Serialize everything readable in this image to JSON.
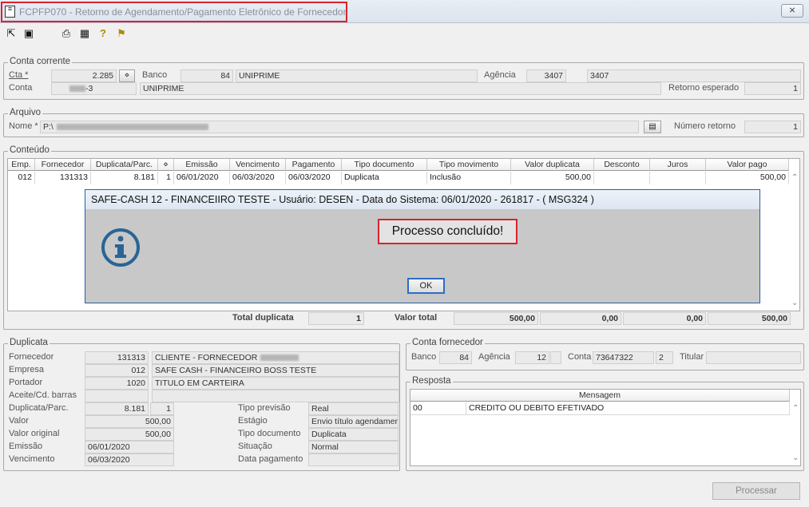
{
  "window": {
    "title": "FCPFP070 - Retorno de Agendamento/Pagamento Eletrônico de Fornecedor",
    "close_glyph": "⨯"
  },
  "toolbar": {
    "icons": [
      "exit-icon",
      "restore-icon",
      "print-icon",
      "calendar-icon",
      "help-icon",
      "bookmark-icon"
    ]
  },
  "conta": {
    "legend": "Conta corrente",
    "cta_label": "Cta *",
    "cta_value": "2.285",
    "banco_label": "Banco",
    "banco_code": "84",
    "banco_name": "UNIPRIME",
    "agencia_label": "Agência",
    "agencia_code": "3407",
    "agencia_name": "3407",
    "conta_label": "Conta",
    "conta_value": "-3",
    "conta_name": "UNIPRIME",
    "retorno_label": "Retorno esperado",
    "retorno_value": "1"
  },
  "arquivo": {
    "legend": "Arquivo",
    "nome_label": "Nome *",
    "nome_value": "P:\\",
    "numero_label": "Número retorno",
    "numero_value": "1"
  },
  "conteudo": {
    "legend": "Conteúdo",
    "headers": [
      "Emp.",
      "Fornecedor",
      "Duplicata/Parc.",
      "",
      "Emissão",
      "Vencimento",
      "Pagamento",
      "Tipo documento",
      "Tipo movimento",
      "Valor duplicata",
      "Desconto",
      "Juros",
      "Valor pago"
    ],
    "row": [
      "012",
      "131313",
      "8.181",
      "1",
      "06/01/2020",
      "06/03/2020",
      "06/03/2020",
      "Duplicata",
      "Inclusão",
      "500,00",
      "",
      "",
      "500,00"
    ],
    "total_dup_label": "Total duplicata",
    "total_dup_value": "1",
    "valor_total_label": "Valor total",
    "totals": [
      "500,00",
      "0,00",
      "0,00",
      "500,00"
    ]
  },
  "dialog": {
    "title": "SAFE-CASH 12 - FINANCEIIRO TESTE - Usuário: DESEN - Data do Sistema: 06/01/2020 - 261817 - ( MSG324 )",
    "message": "Processo concluído!",
    "ok_label": "OK",
    "icon": "info-icon",
    "accent": "#2a6496"
  },
  "duplicata": {
    "legend": "Duplicata",
    "fornecedor_label": "Fornecedor",
    "fornecedor_code": "131313",
    "fornecedor_name": "CLIENTE - FORNECEDOR",
    "empresa_label": "Empresa",
    "empresa_code": "012",
    "empresa_name": "SAFE CASH - FINANCEIRO BOSS TESTE",
    "portador_label": "Portador",
    "portador_code": "1020",
    "portador_name": "TITULO EM CARTEIRA",
    "aceite_label": "Aceite/Cd. barras",
    "dupparc_label": "Duplicata/Parc.",
    "dup_value": "8.181",
    "parc_value": "1",
    "valor_label": "Valor",
    "valor_value": "500,00",
    "valor_original_label": "Valor original",
    "valor_original_value": "500,00",
    "emissao_label": "Emissão",
    "emissao_value": "06/01/2020",
    "vencimento_label": "Vencimento",
    "vencimento_value": "06/03/2020",
    "tipo_previsao_label": "Tipo previsão",
    "tipo_previsao_value": "Real",
    "estagio_label": "Estágio",
    "estagio_value": "Envio título agendamen",
    "tipo_documento_label": "Tipo documento",
    "tipo_documento_value": "Duplicata",
    "situacao_label": "Situação",
    "situacao_value": "Normal",
    "data_pagamento_label": "Data pagamento",
    "data_pagamento_value": ""
  },
  "conta_fornecedor": {
    "legend": "Conta fornecedor",
    "banco_label": "Banco",
    "banco_value": "84",
    "agencia_label": "Agência",
    "agencia_value": "12",
    "conta_label": "Conta",
    "conta_value": "73647322",
    "conta_dv": "2",
    "titular_label": "Titular",
    "titular_value": ""
  },
  "resposta": {
    "legend": "Resposta",
    "header": "Mensagem",
    "code": "00",
    "message": "CREDITO OU DEBITO EFETIVADO"
  },
  "processar_label": "Processar"
}
